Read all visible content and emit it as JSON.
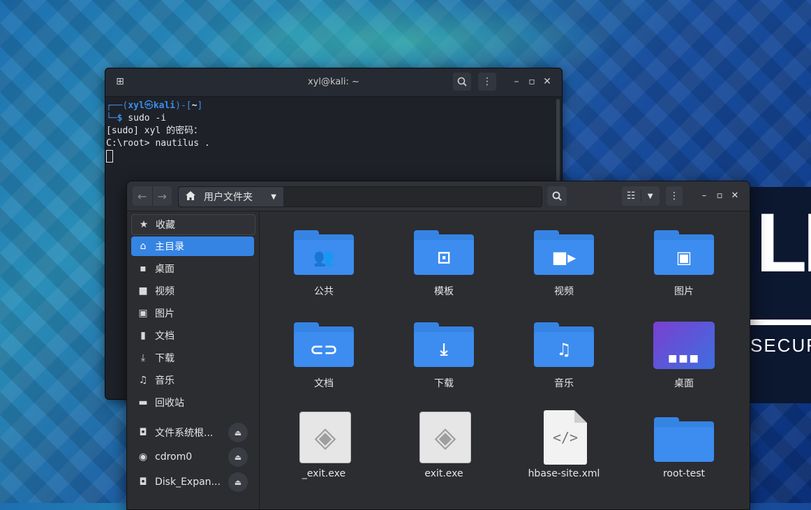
{
  "desktop": {
    "banner_text": "LI",
    "banner_sub": "SECUR"
  },
  "terminal": {
    "title": "xyl@kali: ~",
    "lines": {
      "prompt_open": "┌──(",
      "user": "xyl",
      "at": "㉿",
      "host": "kali",
      "prompt_close": ")-[",
      "cwd": "~",
      "prompt_end": "]",
      "prompt2": "└─",
      "dollar": "$",
      "cmd": " sudo -i",
      "line3": "[sudo] xyl 的密码：",
      "line4": "C:\\root> nautilus ."
    },
    "icons": {
      "new_tab": "new-tab-icon",
      "search": "search-icon",
      "menu": "kebab-menu-icon",
      "minimize": "minimize-icon",
      "maximize": "maximize-icon",
      "close": "close-icon"
    }
  },
  "files": {
    "path_label": "用户文件夹",
    "sidebar": {
      "items": [
        {
          "label": "收藏",
          "icon": "star-icon"
        },
        {
          "label": "主目录",
          "icon": "home-icon"
        },
        {
          "label": "桌面",
          "icon": "desktop-icon"
        },
        {
          "label": "视频",
          "icon": "video-icon"
        },
        {
          "label": "图片",
          "icon": "image-icon"
        },
        {
          "label": "文档",
          "icon": "document-icon"
        },
        {
          "label": "下载",
          "icon": "download-icon"
        },
        {
          "label": "音乐",
          "icon": "music-icon"
        },
        {
          "label": "回收站",
          "icon": "trash-icon"
        },
        {
          "label": "文件系统根...",
          "icon": "drive-icon"
        },
        {
          "label": "cdrom0",
          "icon": "disc-icon"
        },
        {
          "label": "Disk_Expan...",
          "icon": "drive-icon"
        }
      ]
    },
    "grid": [
      {
        "label": "公共",
        "icon": "people-folder-icon"
      },
      {
        "label": "模板",
        "icon": "template-folder-icon"
      },
      {
        "label": "视频",
        "icon": "video-folder-icon"
      },
      {
        "label": "图片",
        "icon": "picture-folder-icon"
      },
      {
        "label": "文档",
        "icon": "document-folder-icon"
      },
      {
        "label": "下载",
        "icon": "download-folder-icon"
      },
      {
        "label": "音乐",
        "icon": "music-folder-icon"
      },
      {
        "label": "桌面",
        "icon": "desktop-folder-icon"
      },
      {
        "label": "_exit.exe",
        "icon": "exe-file-icon"
      },
      {
        "label": "exit.exe",
        "icon": "exe-file-icon"
      },
      {
        "label": "hbase-site.xml",
        "icon": "xml-file-icon"
      },
      {
        "label": "root-test",
        "icon": "folder-icon"
      }
    ],
    "accent": "#3584e4"
  }
}
